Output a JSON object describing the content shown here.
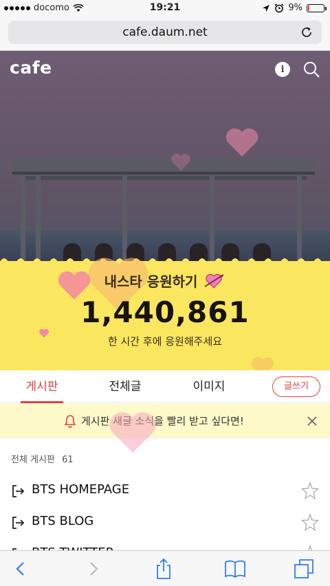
{
  "status_bar": {
    "carrier": "docomo",
    "time": "19:21",
    "battery": "9%",
    "battery_level": 0.09
  },
  "browser": {
    "url": "cafe.daum.net"
  },
  "hero": {
    "logo": "cafe",
    "cheer_title": "내스타 응원하기",
    "cheer_count": "1,440,861",
    "cheer_subtitle": "한 시간 후에 응원해주세요"
  },
  "tabs": [
    {
      "label": "게시판",
      "active": true
    },
    {
      "label": "전체글",
      "active": false
    },
    {
      "label": "이미지",
      "active": false
    }
  ],
  "write_button": "글쓰기",
  "notice": {
    "text": "게시판 새글 소식을 빨리 받고 싶다면!"
  },
  "board": {
    "title": "전체 게시판",
    "count": "61",
    "items": [
      {
        "label": "BTS HOMEPAGE",
        "icon": "link-icon"
      },
      {
        "label": "BTS BLOG",
        "icon": "link-icon"
      },
      {
        "label": "BTS TWITTER",
        "icon": "link-icon"
      }
    ]
  },
  "toolbar": [
    "back-icon",
    "forward-icon",
    "share-icon",
    "bookmarks-icon",
    "tabs-icon"
  ],
  "colors": {
    "accent": "#e0403b",
    "yellow": "#fbe660",
    "notice_bg": "#fdf9c9"
  }
}
